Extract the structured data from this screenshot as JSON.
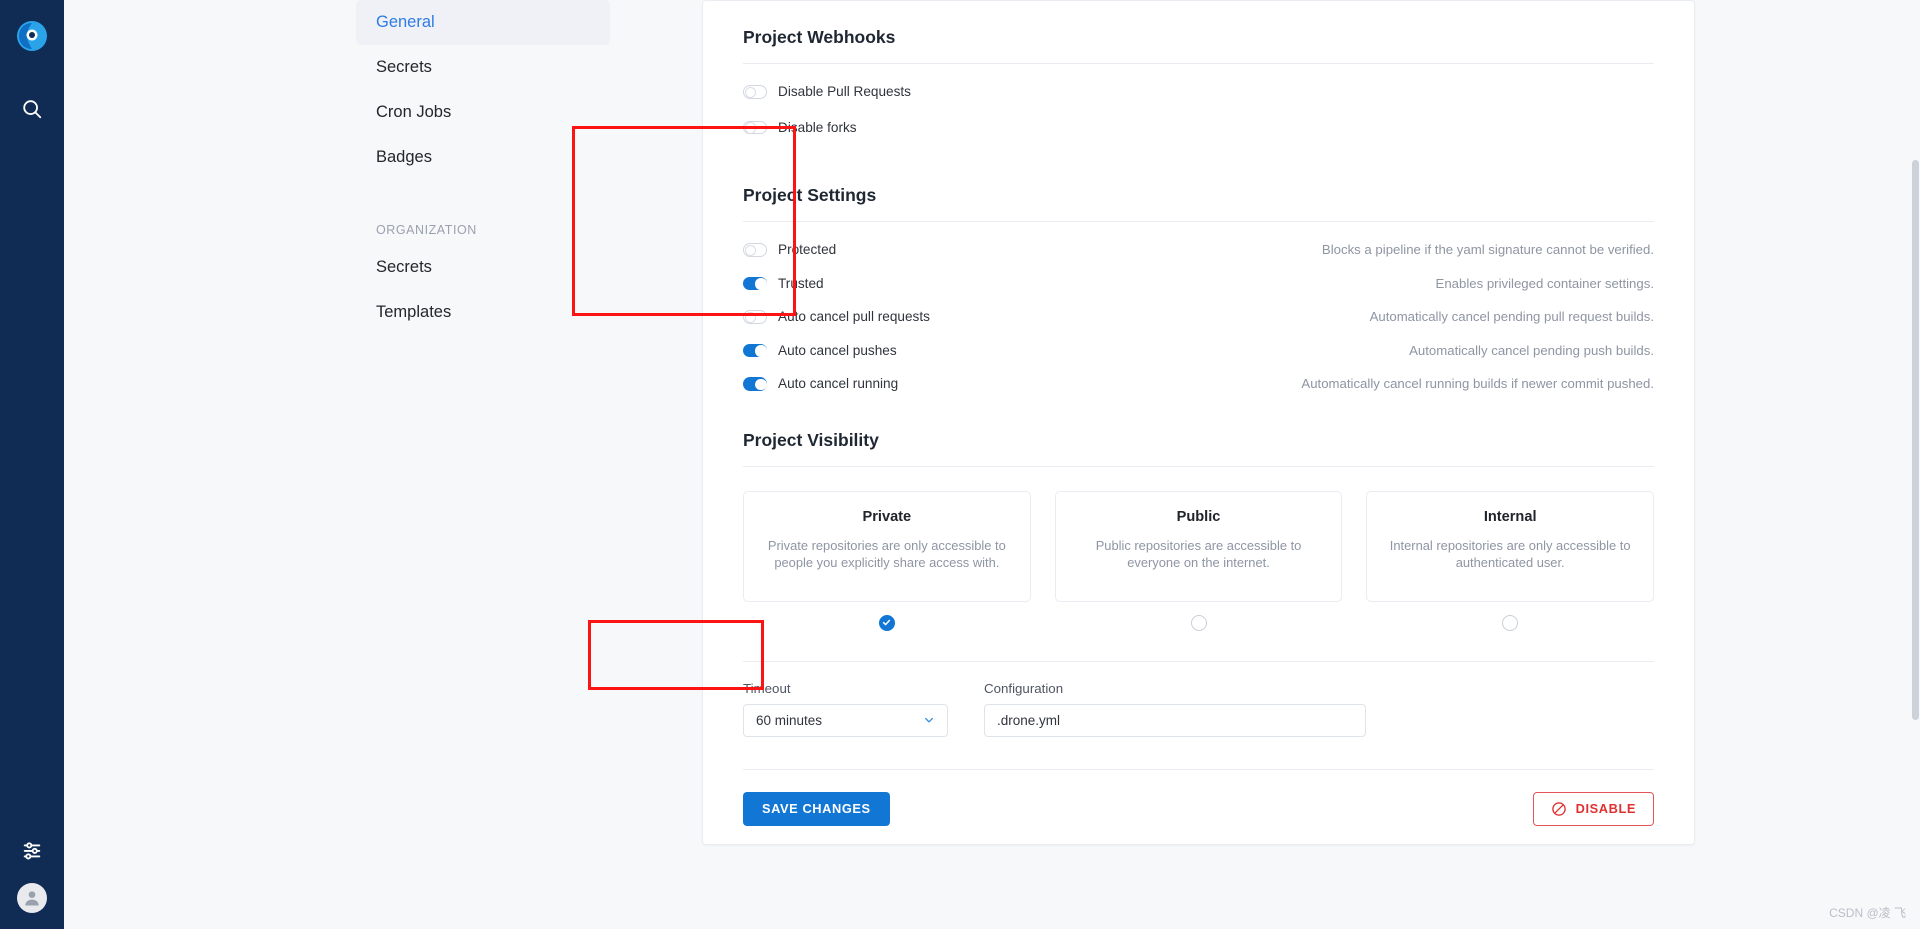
{
  "rail": {
    "logo_icon": "drone-logo-icon",
    "search_icon": "search-icon",
    "sliders_icon": "sliders-icon",
    "avatar_icon": "user-avatar-icon"
  },
  "settings_nav": {
    "items": [
      {
        "label": "General",
        "active": true
      },
      {
        "label": "Secrets",
        "active": false
      },
      {
        "label": "Cron Jobs",
        "active": false
      },
      {
        "label": "Badges",
        "active": false
      }
    ],
    "group_label": "ORGANIZATION",
    "group_items": [
      {
        "label": "Secrets",
        "active": false
      },
      {
        "label": "Templates",
        "active": false
      }
    ]
  },
  "webhooks": {
    "title": "Project Webhooks",
    "toggles": [
      {
        "label": "Disable Pull Requests",
        "on": false,
        "desc": ""
      },
      {
        "label": "Disable forks",
        "on": false,
        "desc": ""
      }
    ]
  },
  "project_settings": {
    "title": "Project Settings",
    "toggles": [
      {
        "label": "Protected",
        "on": false,
        "desc": "Blocks a pipeline if the yaml signature cannot be verified."
      },
      {
        "label": "Trusted",
        "on": true,
        "desc": "Enables privileged container settings."
      },
      {
        "label": "Auto cancel pull requests",
        "on": false,
        "desc": "Automatically cancel pending pull request builds."
      },
      {
        "label": "Auto cancel pushes",
        "on": true,
        "desc": "Automatically cancel pending push builds."
      },
      {
        "label": "Auto cancel running",
        "on": true,
        "desc": "Automatically cancel running builds if newer commit pushed."
      }
    ]
  },
  "visibility": {
    "title": "Project Visibility",
    "options": [
      {
        "name": "Private",
        "desc": "Private repositories are only accessible to people you explicitly share access with.",
        "selected": true
      },
      {
        "name": "Public",
        "desc": "Public repositories are accessible to everyone on the internet.",
        "selected": false
      },
      {
        "name": "Internal",
        "desc": "Internal repositories are only accessible to authenticated user.",
        "selected": false
      }
    ]
  },
  "fields": {
    "timeout_label": "Timeout",
    "timeout_value": "60 minutes",
    "timeout_icon": "chevron-down-icon",
    "configuration_label": "Configuration",
    "configuration_value": ".drone.yml",
    "configuration_placeholder": ".drone.yml"
  },
  "actions": {
    "save_label": "SAVE CHANGES",
    "disable_label": "DISABLE",
    "disable_icon": "no-entry-icon"
  },
  "colors": {
    "accent": "#1277d4",
    "danger": "#e03131",
    "rail_bg": "#112c54",
    "annotation": "#fc1414"
  },
  "watermark": "CSDN @凌 飞"
}
